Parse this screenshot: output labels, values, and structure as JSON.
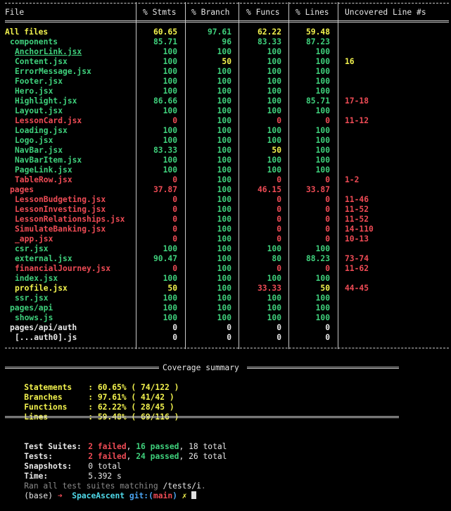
{
  "table": {
    "headers": [
      "File",
      "% Stmts",
      "% Branch",
      "% Funcs",
      "% Lines",
      "Uncovered Line #s"
    ],
    "rows": [
      {
        "file": "All files",
        "indent": 0,
        "file_color": "yellow",
        "underline": false,
        "stmts": "60.65",
        "stmts_color": "yellow",
        "branch": "97.61",
        "branch_color": "green",
        "funcs": "62.22",
        "funcs_color": "yellow",
        "lines": "59.48",
        "lines_color": "yellow",
        "uncovered": "",
        "bold": true
      },
      {
        "file": "components",
        "indent": 1,
        "file_color": "green",
        "underline": false,
        "stmts": "85.71",
        "stmts_color": "green",
        "branch": "96",
        "branch_color": "green",
        "funcs": "83.33",
        "funcs_color": "green",
        "lines": "87.23",
        "lines_color": "green",
        "uncovered": ""
      },
      {
        "file": "AnchorLink.jsx",
        "indent": 2,
        "file_color": "green",
        "underline": true,
        "stmts": "100",
        "stmts_color": "green",
        "branch": "100",
        "branch_color": "green",
        "funcs": "100",
        "funcs_color": "green",
        "lines": "100",
        "lines_color": "green",
        "uncovered": ""
      },
      {
        "file": "Content.jsx",
        "indent": 2,
        "file_color": "green",
        "underline": false,
        "stmts": "100",
        "stmts_color": "green",
        "branch": "50",
        "branch_color": "yellow",
        "funcs": "100",
        "funcs_color": "green",
        "lines": "100",
        "lines_color": "green",
        "uncovered": "16",
        "uncovered_color": "yellow"
      },
      {
        "file": "ErrorMessage.jsx",
        "indent": 2,
        "file_color": "green",
        "underline": false,
        "stmts": "100",
        "stmts_color": "green",
        "branch": "100",
        "branch_color": "green",
        "funcs": "100",
        "funcs_color": "green",
        "lines": "100",
        "lines_color": "green",
        "uncovered": ""
      },
      {
        "file": "Footer.jsx",
        "indent": 2,
        "file_color": "green",
        "underline": false,
        "stmts": "100",
        "stmts_color": "green",
        "branch": "100",
        "branch_color": "green",
        "funcs": "100",
        "funcs_color": "green",
        "lines": "100",
        "lines_color": "green",
        "uncovered": ""
      },
      {
        "file": "Hero.jsx",
        "indent": 2,
        "file_color": "green",
        "underline": false,
        "stmts": "100",
        "stmts_color": "green",
        "branch": "100",
        "branch_color": "green",
        "funcs": "100",
        "funcs_color": "green",
        "lines": "100",
        "lines_color": "green",
        "uncovered": ""
      },
      {
        "file": "Highlight.jsx",
        "indent": 2,
        "file_color": "green",
        "underline": false,
        "stmts": "86.66",
        "stmts_color": "green",
        "branch": "100",
        "branch_color": "green",
        "funcs": "100",
        "funcs_color": "green",
        "lines": "85.71",
        "lines_color": "green",
        "uncovered": "17-18",
        "uncovered_color": "red"
      },
      {
        "file": "Layout.jsx",
        "indent": 2,
        "file_color": "green",
        "underline": false,
        "stmts": "100",
        "stmts_color": "green",
        "branch": "100",
        "branch_color": "green",
        "funcs": "100",
        "funcs_color": "green",
        "lines": "100",
        "lines_color": "green",
        "uncovered": ""
      },
      {
        "file": "LessonCard.jsx",
        "indent": 2,
        "file_color": "red",
        "underline": false,
        "stmts": "0",
        "stmts_color": "red",
        "branch": "100",
        "branch_color": "green",
        "funcs": "0",
        "funcs_color": "red",
        "lines": "0",
        "lines_color": "red",
        "uncovered": "11-12",
        "uncovered_color": "red"
      },
      {
        "file": "Loading.jsx",
        "indent": 2,
        "file_color": "green",
        "underline": false,
        "stmts": "100",
        "stmts_color": "green",
        "branch": "100",
        "branch_color": "green",
        "funcs": "100",
        "funcs_color": "green",
        "lines": "100",
        "lines_color": "green",
        "uncovered": ""
      },
      {
        "file": "Logo.jsx",
        "indent": 2,
        "file_color": "green",
        "underline": false,
        "stmts": "100",
        "stmts_color": "green",
        "branch": "100",
        "branch_color": "green",
        "funcs": "100",
        "funcs_color": "green",
        "lines": "100",
        "lines_color": "green",
        "uncovered": ""
      },
      {
        "file": "NavBar.jsx",
        "indent": 2,
        "file_color": "green",
        "underline": false,
        "stmts": "83.33",
        "stmts_color": "green",
        "branch": "100",
        "branch_color": "green",
        "funcs": "50",
        "funcs_color": "yellow",
        "lines": "100",
        "lines_color": "green",
        "uncovered": ""
      },
      {
        "file": "NavBarItem.jsx",
        "indent": 2,
        "file_color": "green",
        "underline": false,
        "stmts": "100",
        "stmts_color": "green",
        "branch": "100",
        "branch_color": "green",
        "funcs": "100",
        "funcs_color": "green",
        "lines": "100",
        "lines_color": "green",
        "uncovered": ""
      },
      {
        "file": "PageLink.jsx",
        "indent": 2,
        "file_color": "green",
        "underline": false,
        "stmts": "100",
        "stmts_color": "green",
        "branch": "100",
        "branch_color": "green",
        "funcs": "100",
        "funcs_color": "green",
        "lines": "100",
        "lines_color": "green",
        "uncovered": ""
      },
      {
        "file": "TableRow.jsx",
        "indent": 2,
        "file_color": "red",
        "underline": false,
        "stmts": "0",
        "stmts_color": "red",
        "branch": "100",
        "branch_color": "green",
        "funcs": "0",
        "funcs_color": "red",
        "lines": "0",
        "lines_color": "red",
        "uncovered": "1-2",
        "uncovered_color": "red"
      },
      {
        "file": "pages",
        "indent": 1,
        "file_color": "red",
        "underline": false,
        "stmts": "37.87",
        "stmts_color": "red",
        "branch": "100",
        "branch_color": "green",
        "funcs": "46.15",
        "funcs_color": "red",
        "lines": "33.87",
        "lines_color": "red",
        "uncovered": ""
      },
      {
        "file": "LessonBudgeting.jsx",
        "indent": 2,
        "file_color": "red",
        "underline": false,
        "stmts": "0",
        "stmts_color": "red",
        "branch": "100",
        "branch_color": "green",
        "funcs": "0",
        "funcs_color": "red",
        "lines": "0",
        "lines_color": "red",
        "uncovered": "11-46",
        "uncovered_color": "red"
      },
      {
        "file": "LessonInvesting.jsx",
        "indent": 2,
        "file_color": "red",
        "underline": false,
        "stmts": "0",
        "stmts_color": "red",
        "branch": "100",
        "branch_color": "green",
        "funcs": "0",
        "funcs_color": "red",
        "lines": "0",
        "lines_color": "red",
        "uncovered": "11-52",
        "uncovered_color": "red"
      },
      {
        "file": "LessonRelationships.jsx",
        "indent": 2,
        "file_color": "red",
        "underline": false,
        "stmts": "0",
        "stmts_color": "red",
        "branch": "100",
        "branch_color": "green",
        "funcs": "0",
        "funcs_color": "red",
        "lines": "0",
        "lines_color": "red",
        "uncovered": "11-52",
        "uncovered_color": "red"
      },
      {
        "file": "SimulateBanking.jsx",
        "indent": 2,
        "file_color": "red",
        "underline": false,
        "stmts": "0",
        "stmts_color": "red",
        "branch": "100",
        "branch_color": "green",
        "funcs": "0",
        "funcs_color": "red",
        "lines": "0",
        "lines_color": "red",
        "uncovered": "14-110",
        "uncovered_color": "red"
      },
      {
        "file": "_app.jsx",
        "indent": 2,
        "file_color": "red",
        "underline": false,
        "stmts": "0",
        "stmts_color": "red",
        "branch": "100",
        "branch_color": "green",
        "funcs": "0",
        "funcs_color": "red",
        "lines": "0",
        "lines_color": "red",
        "uncovered": "10-13",
        "uncovered_color": "red"
      },
      {
        "file": "csr.jsx",
        "indent": 2,
        "file_color": "green",
        "underline": false,
        "stmts": "100",
        "stmts_color": "green",
        "branch": "100",
        "branch_color": "green",
        "funcs": "100",
        "funcs_color": "green",
        "lines": "100",
        "lines_color": "green",
        "uncovered": ""
      },
      {
        "file": "external.jsx",
        "indent": 2,
        "file_color": "green",
        "underline": false,
        "stmts": "90.47",
        "stmts_color": "green",
        "branch": "100",
        "branch_color": "green",
        "funcs": "80",
        "funcs_color": "green",
        "lines": "88.23",
        "lines_color": "green",
        "uncovered": "73-74",
        "uncovered_color": "red"
      },
      {
        "file": "financialJourney.jsx",
        "indent": 2,
        "file_color": "red",
        "underline": false,
        "stmts": "0",
        "stmts_color": "red",
        "branch": "100",
        "branch_color": "green",
        "funcs": "0",
        "funcs_color": "red",
        "lines": "0",
        "lines_color": "red",
        "uncovered": "11-62",
        "uncovered_color": "red"
      },
      {
        "file": "index.jsx",
        "indent": 2,
        "file_color": "green",
        "underline": false,
        "stmts": "100",
        "stmts_color": "green",
        "branch": "100",
        "branch_color": "green",
        "funcs": "100",
        "funcs_color": "green",
        "lines": "100",
        "lines_color": "green",
        "uncovered": ""
      },
      {
        "file": "profile.jsx",
        "indent": 2,
        "file_color": "yellow",
        "underline": false,
        "stmts": "50",
        "stmts_color": "yellow",
        "branch": "100",
        "branch_color": "green",
        "funcs": "33.33",
        "funcs_color": "red",
        "lines": "50",
        "lines_color": "yellow",
        "uncovered": "44-45",
        "uncovered_color": "red"
      },
      {
        "file": "ssr.jsx",
        "indent": 2,
        "file_color": "green",
        "underline": false,
        "stmts": "100",
        "stmts_color": "green",
        "branch": "100",
        "branch_color": "green",
        "funcs": "100",
        "funcs_color": "green",
        "lines": "100",
        "lines_color": "green",
        "uncovered": ""
      },
      {
        "file": "pages/api",
        "indent": 1,
        "file_color": "green",
        "underline": false,
        "stmts": "100",
        "stmts_color": "green",
        "branch": "100",
        "branch_color": "green",
        "funcs": "100",
        "funcs_color": "green",
        "lines": "100",
        "lines_color": "green",
        "uncovered": ""
      },
      {
        "file": "shows.js",
        "indent": 2,
        "file_color": "green",
        "underline": false,
        "stmts": "100",
        "stmts_color": "green",
        "branch": "100",
        "branch_color": "green",
        "funcs": "100",
        "funcs_color": "green",
        "lines": "100",
        "lines_color": "green",
        "uncovered": ""
      },
      {
        "file": "pages/api/auth",
        "indent": 1,
        "file_color": "white",
        "underline": false,
        "stmts": "0",
        "stmts_color": "white",
        "branch": "0",
        "branch_color": "white",
        "funcs": "0",
        "funcs_color": "white",
        "lines": "0",
        "lines_color": "white",
        "uncovered": ""
      },
      {
        "file": "[...auth0].js",
        "indent": 2,
        "file_color": "white",
        "underline": false,
        "stmts": "0",
        "stmts_color": "white",
        "branch": "0",
        "branch_color": "white",
        "funcs": "0",
        "funcs_color": "white",
        "lines": "0",
        "lines_color": "white",
        "uncovered": ""
      }
    ]
  },
  "summary": {
    "title": "Coverage summary",
    "lines": [
      {
        "label": "Statements",
        "value": ": 60.65% ( 74/122 )"
      },
      {
        "label": "Branches",
        "value": ": 97.61% ( 41/42 )"
      },
      {
        "label": "Functions",
        "value": ": 62.22% ( 28/45 )"
      },
      {
        "label": "Lines",
        "value": ": 59.48% ( 69/116 )"
      }
    ]
  },
  "results": {
    "suites": {
      "label": "Test Suites:",
      "failed": "2 failed",
      "passed": "16 passed",
      "total": ", 18 total"
    },
    "tests": {
      "label": "Tests:",
      "failed": "2 failed",
      "passed": "24 passed",
      "total": ", 26 total"
    },
    "snapshots": {
      "label": "Snapshots:",
      "value": "0 total"
    },
    "time": {
      "label": "Time:",
      "value": "5.392 s"
    },
    "ran": {
      "prefix": "Ran all test suites matching ",
      "pattern": "/tests/i",
      "suffix": "."
    }
  },
  "prompt": {
    "env": "(base)",
    "arrow": "➜",
    "dir": "SpaceAscent",
    "git_label": "git:(",
    "branch": "main",
    "git_close": ")",
    "dirty": "✗"
  },
  "colors": {
    "green": "#3fd07c",
    "red": "#ee4b55",
    "yellow": "#f3f34e",
    "white": "#e8e8e8"
  }
}
